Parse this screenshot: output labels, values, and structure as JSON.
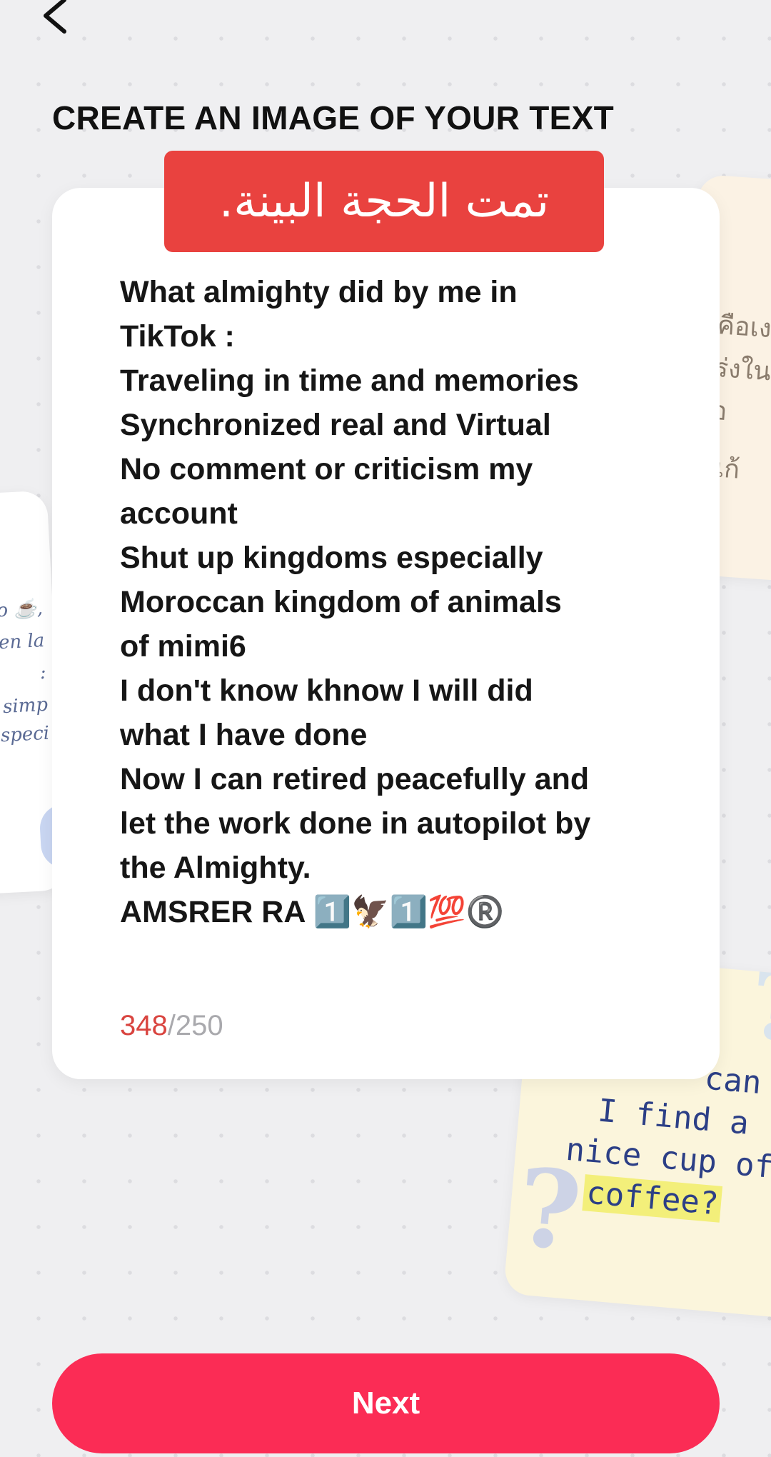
{
  "header": {
    "back_icon": "chevron-left-icon",
    "title": "CREATE AN IMAGE OF YOUR TEXT"
  },
  "card": {
    "banner_text": "تمت الحجة البينة.",
    "banner_color": "#e9423f",
    "body_text": "What almighty did by me in\nTikTok :\nTraveling in time and memories\nSynchronized real and Virtual\nNo comment or criticism my\naccount\nShut up kingdoms especially\nMoroccan kingdom of animals\nof mimi6\nI don't know khnow I will did\nwhat I have done\nNow I can retired peacefully and\nlet the work done in autopilot by\nthe Almighty.\nAMSRER RA 1️⃣🦅1️⃣💯®️",
    "char_count": "348",
    "char_limit": "/250",
    "count_over_color": "#d9443f"
  },
  "background_samples": {
    "right_lines": [
      "คือเง",
      "ร่งใน",
      "อ",
      "แก้"
    ],
    "left_lines": [
      "ito ☕,",
      "en la",
      ":",
      "ás simp",
      "especi"
    ],
    "bottom_lines": [
      "can",
      "I find a",
      "nice cup of",
      "coffee?"
    ]
  },
  "footer": {
    "next_label": "Next",
    "accent_color": "#fb2c55"
  }
}
